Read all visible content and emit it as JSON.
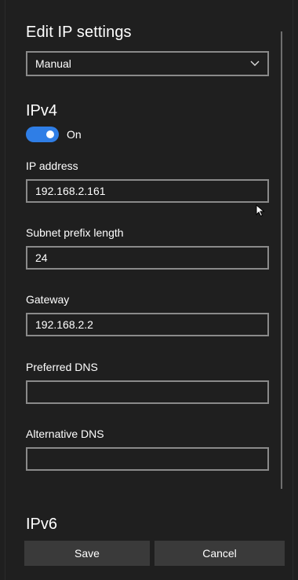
{
  "dialog": {
    "title": "Edit IP settings",
    "mode_select": {
      "value": "Manual"
    }
  },
  "ipv4": {
    "title": "IPv4",
    "toggle": {
      "state": "On"
    },
    "fields": [
      {
        "label": "IP address",
        "value": "192.168.2.161",
        "placeholder": ""
      },
      {
        "label": "Subnet prefix length",
        "value": "24",
        "placeholder": ""
      },
      {
        "label": "Gateway",
        "value": "192.168.2.2",
        "placeholder": ""
      },
      {
        "label": "Preferred DNS",
        "value": "",
        "placeholder": ""
      },
      {
        "label": "Alternative DNS",
        "value": "",
        "placeholder": ""
      }
    ]
  },
  "ipv6": {
    "title": "IPv6"
  },
  "buttons": {
    "save": "Save",
    "cancel": "Cancel"
  },
  "colors": {
    "background": "#1f1f1f",
    "toggle_on": "#2f7ee6",
    "field_border": "#8a8a8a",
    "button_bg": "#3a3a3a"
  },
  "icons": {
    "dropdown": "chevron-down-icon",
    "cursor": "mouse-pointer-icon"
  }
}
